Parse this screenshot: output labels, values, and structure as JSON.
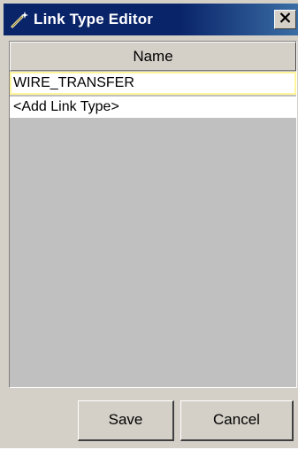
{
  "window": {
    "title": "Link Type Editor",
    "title_icon": "wand-icon",
    "close_icon": "close-icon"
  },
  "table": {
    "columns": [
      "Name"
    ],
    "rows": [
      {
        "name": "WIRE_TRANSFER",
        "selected": true
      },
      {
        "name": "<Add Link Type>",
        "selected": false
      }
    ]
  },
  "footer": {
    "save_label": "Save",
    "cancel_label": "Cancel"
  },
  "colors": {
    "titlebar": "#0a246a",
    "dialog_bg": "#d4d0c8",
    "selection_border": "#fff59a"
  }
}
